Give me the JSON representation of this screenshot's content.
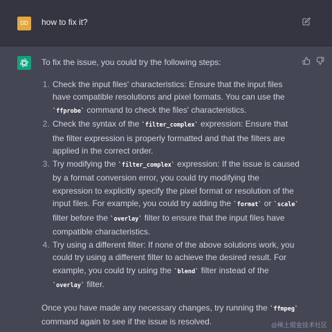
{
  "user": {
    "avatar_initials": "DD",
    "message": "how to fix it?"
  },
  "assistant": {
    "intro": "To fix the issue, you could try the following steps:",
    "steps": [
      {
        "t1": "Check the input files' characteristics: Ensure that the input files have compatible resolutions and pixel formats. You can use the ",
        "c1": "`ffprobe`",
        "t2": " command to check the files' characteristics."
      },
      {
        "t1": "Check the syntax of the ",
        "c1": "`filter_complex`",
        "t2": " expression: Ensure that the filter expression is properly formatted and that the filters are applied in the correct order."
      },
      {
        "t1": "Try modifying the ",
        "c1": "`filter_complex`",
        "t2": " expression: If the issue is caused by a format conversion error, you could try modifying the expression to explicitly specify the pixel format or resolution of the input files. For example, you could try adding the ",
        "c2": "`format`",
        "t3": " or ",
        "c3": "`scale`",
        "t4": " filter before the ",
        "c4": "`overlay`",
        "t5": " filter to ensure that the input files have compatible characteristics."
      },
      {
        "t1": "Try using a different filter: If none of the above solutions work, you could try using a different filter to achieve the desired result. For example, you could try using the ",
        "c1": "`blend`",
        "t2": " filter instead of the ",
        "c2": "`overlay`",
        "t3": " filter."
      }
    ],
    "outro_1": "Once you have made any necessary changes, try running the ",
    "outro_code": "`ffmpeg`",
    "outro_2": " command again to see if the issue is resolved."
  },
  "watermark": "@稀土掘金技术社区",
  "colors": {
    "page_bg": "#444654",
    "user_bg": "#343541",
    "user_avatar": "#e5a83b",
    "bot_avatar": "#10a37f"
  },
  "icons": [
    "edit-icon",
    "thumb-up-icon",
    "thumb-down-icon",
    "openai-logo-icon"
  ]
}
